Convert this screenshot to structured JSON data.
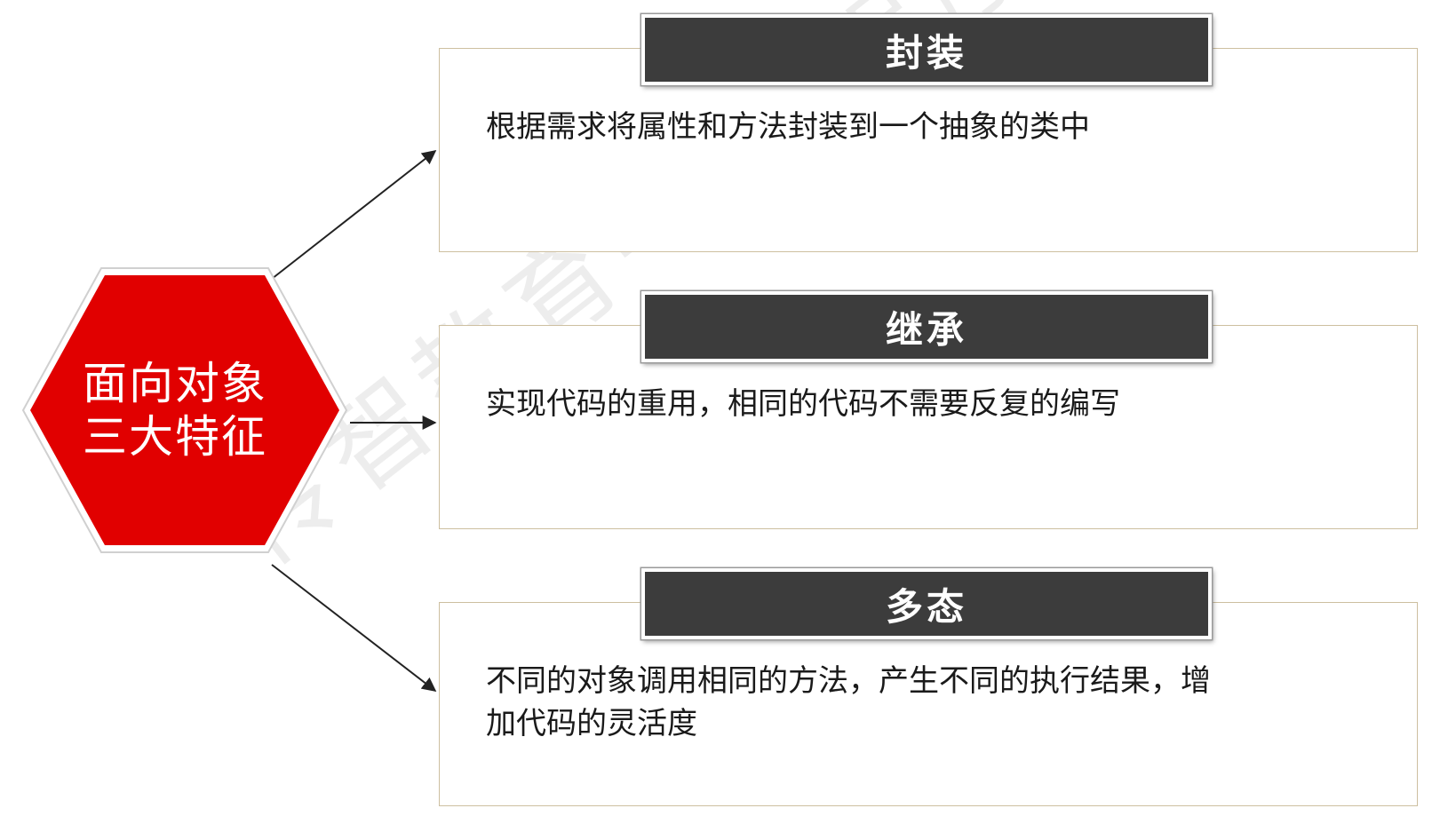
{
  "center": {
    "line1": "面向对象",
    "line2": "三大特征",
    "fill_color": "#e10000"
  },
  "features": [
    {
      "title": "封装",
      "description": "根据需求将属性和方法封装到一个抽象的类中"
    },
    {
      "title": "继承",
      "description": "实现代码的重用，相同的代码不需要反复的编写"
    },
    {
      "title": "多态",
      "description_line1": "不同的对象调用相同的方法，产生不同的执行结果，增",
      "description_line2": "加代码的灵活度"
    }
  ],
  "watermark": "传智教育-黑马程序员",
  "colors": {
    "header_bg": "#3c3c3c",
    "box_border": "#cdbfa0",
    "arrow": "#222222"
  }
}
